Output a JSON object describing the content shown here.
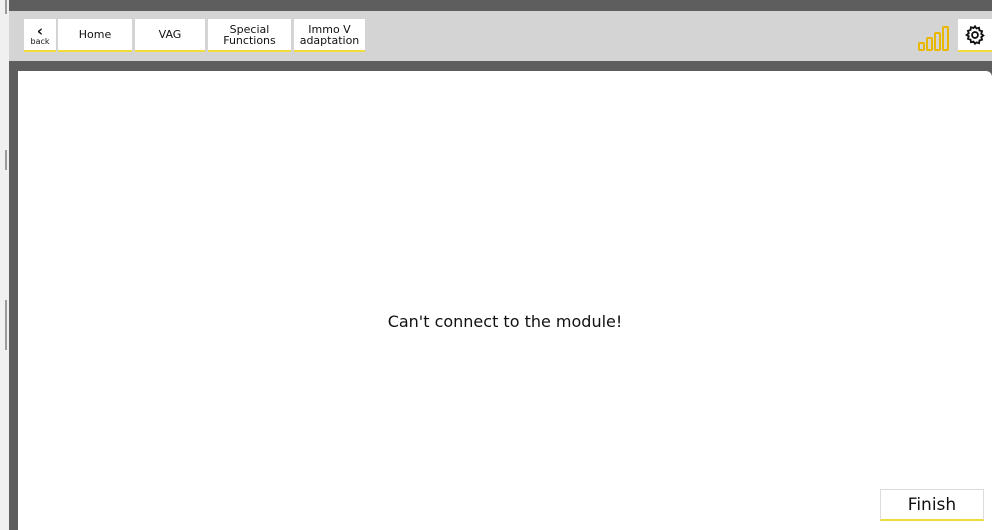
{
  "nav": {
    "back_label": "back",
    "back_icon": "chevron-left-icon",
    "home_label": "Home",
    "vag_label": "VAG",
    "special_label": "Special\nFunctions",
    "immo_label": "Immo V\nadaptation"
  },
  "status": {
    "signal_icon": "signal-strength-icon",
    "settings_icon": "gear-icon"
  },
  "main": {
    "message": "Can't connect to the module!",
    "finish_label": "Finish"
  },
  "colors": {
    "accent": "#f0dc3a",
    "signal": "#e8b800",
    "topbar": "#d4d4d4",
    "frame": "#5e5e5e"
  }
}
